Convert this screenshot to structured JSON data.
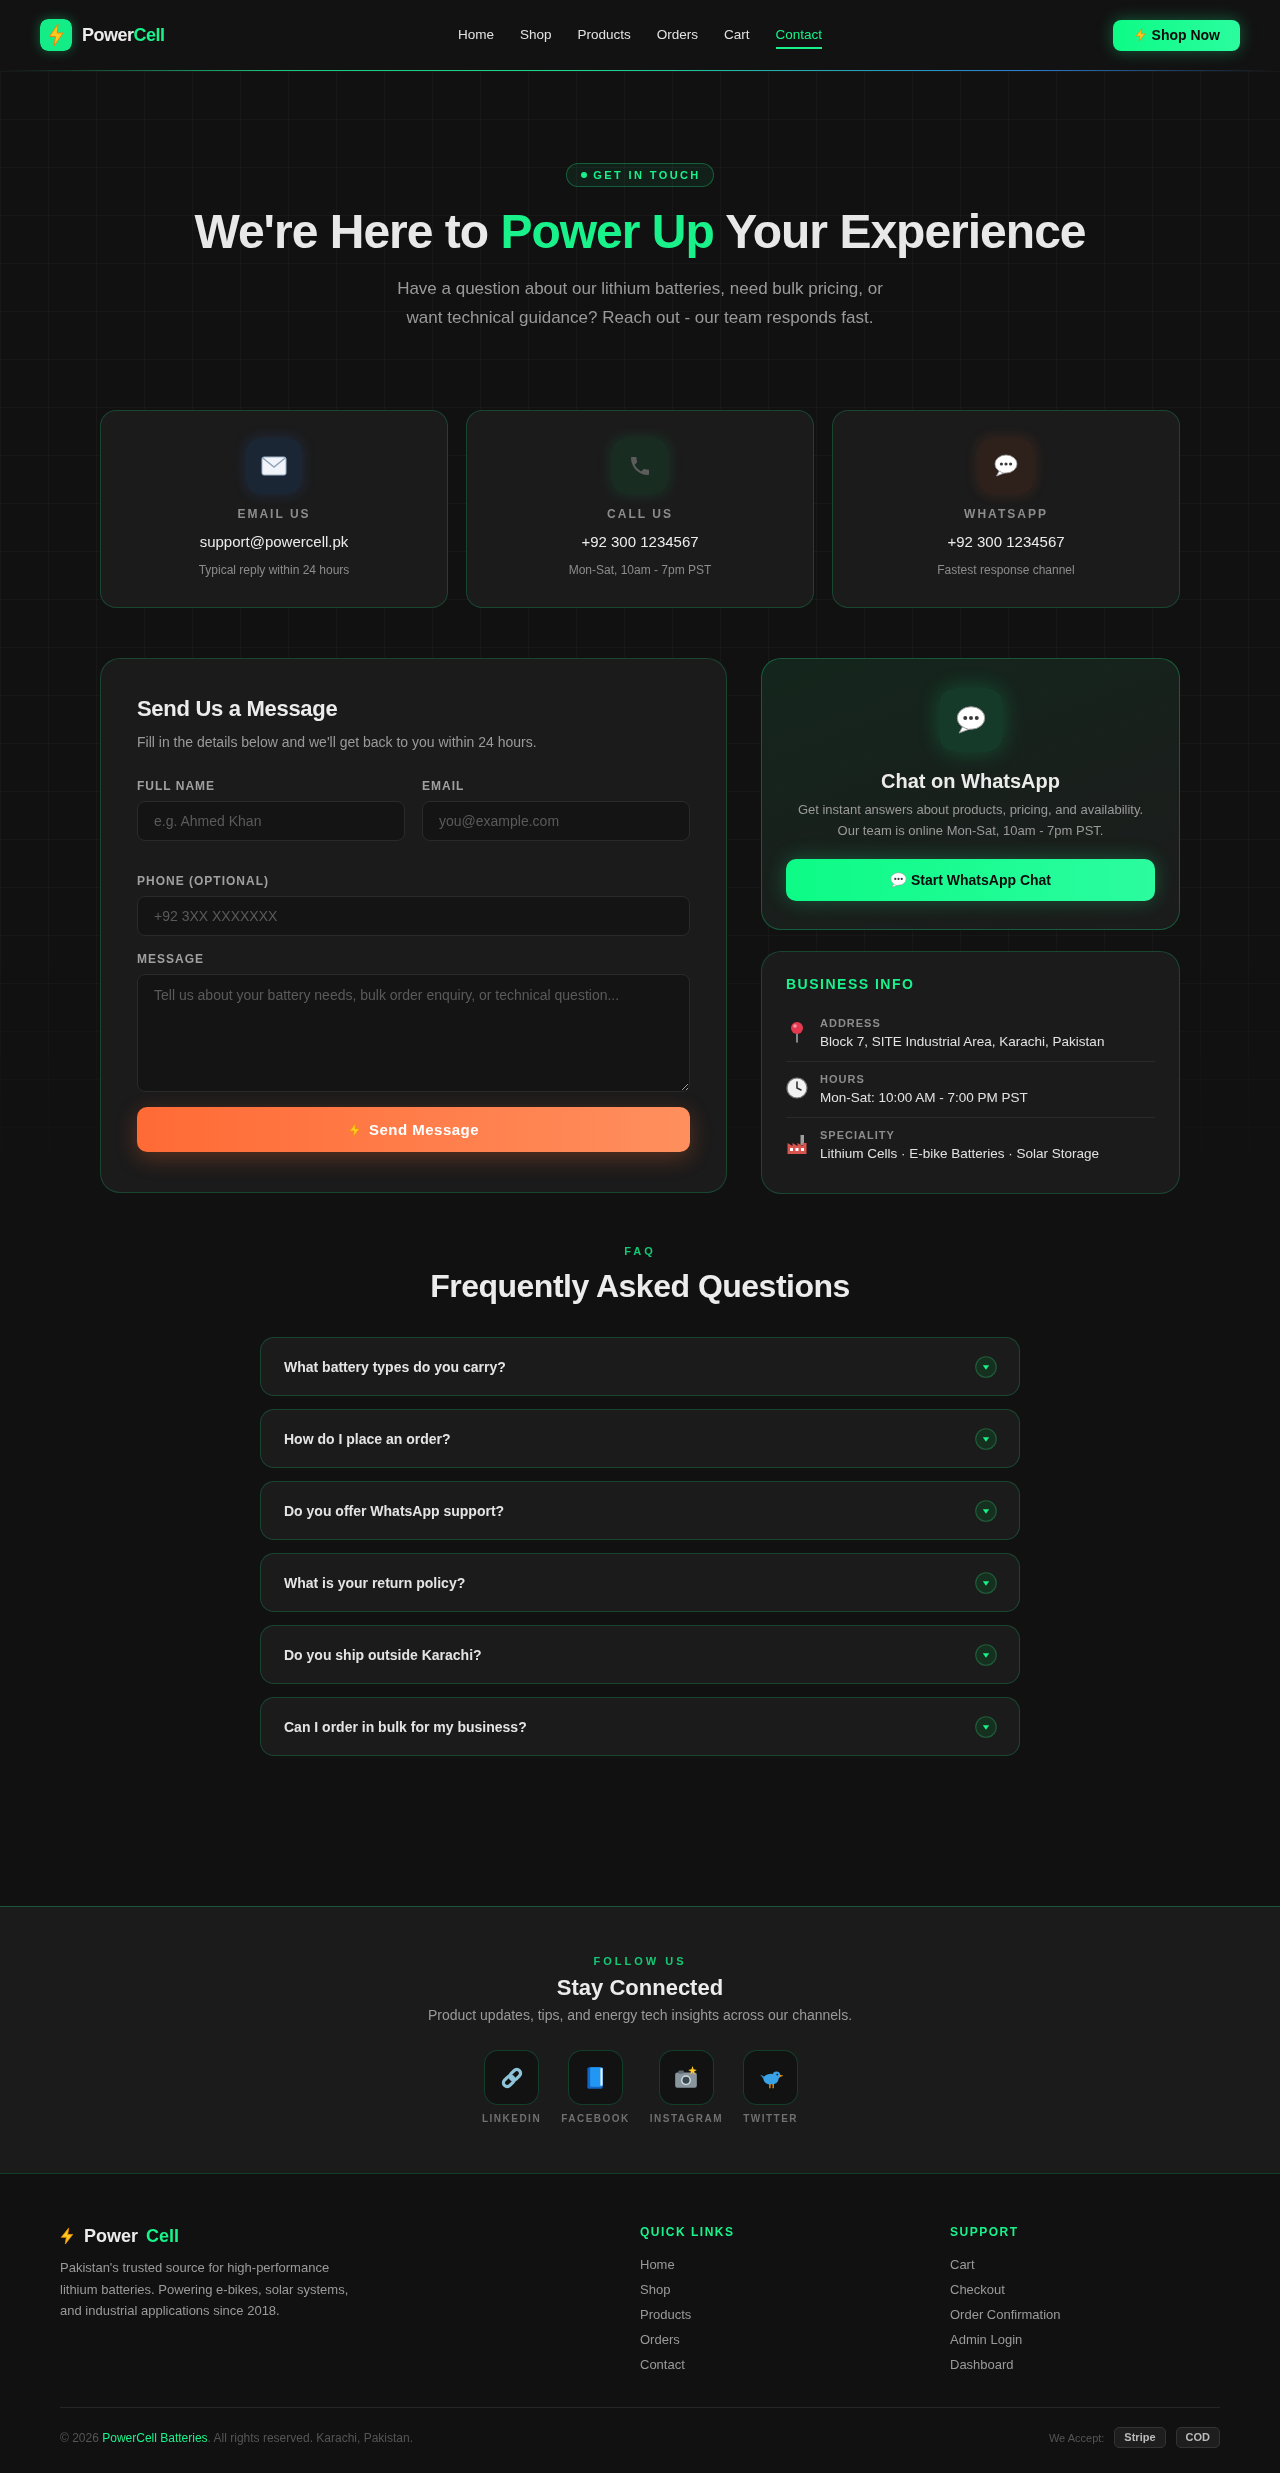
{
  "header": {
    "brand": {
      "text": "Power",
      "accent": "Cell"
    },
    "nav": [
      {
        "label": "Home",
        "selected": false
      },
      {
        "label": "Shop",
        "selected": false
      },
      {
        "label": "Products",
        "selected": false
      },
      {
        "label": "Orders",
        "selected": false
      },
      {
        "label": "Cart",
        "selected": false
      },
      {
        "label": "Contact",
        "selected": true
      }
    ],
    "cta": "Shop Now"
  },
  "hero": {
    "badge": "GET IN TOUCH",
    "title_start": "We're Here to",
    "title_highlight": "Power Up",
    "title_end": "Your Experience",
    "subtitle": "Have a question about our lithium batteries, need bulk pricing, or want technical guidance? Reach out - our team responds fast."
  },
  "contact_cards": [
    {
      "kind": "email",
      "label": "EMAIL US",
      "value": "support@powercell.pk",
      "note": "Typical reply within 24 hours"
    },
    {
      "kind": "phone",
      "label": "CALL US",
      "value": "+92 300 1234567",
      "note": "Mon-Sat, 10am - 7pm PST"
    },
    {
      "kind": "whatsapp",
      "label": "WHATSAPP",
      "value": "+92 300 1234567",
      "note": "Fastest response channel"
    }
  ],
  "message_form": {
    "title": "Send Us a Message",
    "subtitle": "Fill in the details below and we'll get back to you within 24 hours.",
    "rows": [
      [
        {
          "kind": "input",
          "label": "FULL NAME",
          "placeholder": "e.g. Ahmed Khan"
        },
        {
          "kind": "input",
          "label": "EMAIL",
          "placeholder": "you@example.com"
        }
      ],
      [
        {
          "kind": "input",
          "label": "PHONE (OPTIONAL)",
          "placeholder": "+92 3XX XXXXXXX"
        }
      ],
      [
        {
          "kind": "textarea",
          "label": "MESSAGE",
          "placeholder": "Tell us about your battery needs, bulk order enquiry, or technical question..."
        }
      ]
    ],
    "submit": "Send Message"
  },
  "whatsapp_panel": {
    "title": "Chat on WhatsApp",
    "description": "Get instant answers about products, pricing, and availability. Our team is online Mon-Sat, 10am - 7pm PST.",
    "button": "Start WhatsApp Chat"
  },
  "business_info": {
    "title": "BUSINESS INFO",
    "items": [
      {
        "kind": "address",
        "label": "ADDRESS",
        "value": "Block 7, SITE Industrial Area, Karachi, Pakistan"
      },
      {
        "kind": "hours",
        "label": "HOURS",
        "value": "Mon-Sat: 10:00 AM - 7:00 PM PST"
      },
      {
        "kind": "speciality",
        "label": "SPECIALITY",
        "value": "Lithium Cells · E-bike Batteries · Solar Storage"
      }
    ]
  },
  "faq": {
    "eyebrow": "FAQ",
    "title": "Frequently Asked Questions",
    "items": [
      {
        "question": "What battery types do you carry?",
        "expanded": false
      },
      {
        "question": "How do I place an order?",
        "expanded": false
      },
      {
        "question": "Do you offer WhatsApp support?",
        "expanded": false
      },
      {
        "question": "What is your return policy?",
        "expanded": false
      },
      {
        "question": "Do you ship outside Karachi?",
        "expanded": false
      },
      {
        "question": "Can I order in bulk for my business?",
        "expanded": false
      }
    ]
  },
  "follow": {
    "eyebrow": "FOLLOW US",
    "title": "Stay Connected",
    "subtitle": "Product updates, tips, and energy tech insights across our channels.",
    "channels": [
      {
        "kind": "linkedin",
        "label": "LINKEDIN"
      },
      {
        "kind": "facebook",
        "label": "FACEBOOK"
      },
      {
        "kind": "instagram",
        "label": "INSTAGRAM"
      },
      {
        "kind": "twitter",
        "label": "TWITTER"
      }
    ]
  },
  "footer": {
    "brand": {
      "text": "Power",
      "accent": "Cell"
    },
    "description": "Pakistan's trusted source for high-performance lithium batteries. Powering e-bikes, solar systems, and industrial applications since 2018.",
    "columns": [
      {
        "title": "QUICK LINKS",
        "links": [
          "Home",
          "Shop",
          "Products",
          "Orders",
          "Contact"
        ]
      },
      {
        "title": "SUPPORT",
        "links": [
          "Cart",
          "Checkout",
          "Order Confirmation",
          "Admin Login",
          "Dashboard"
        ]
      }
    ],
    "copyright": {
      "text": "© 2026",
      "link": "PowerCell Batteries",
      "rest": ". All rights reserved. Karachi, Pakistan."
    },
    "payments": {
      "label": "We Accept:",
      "methods": [
        "Stripe",
        "COD"
      ]
    }
  }
}
